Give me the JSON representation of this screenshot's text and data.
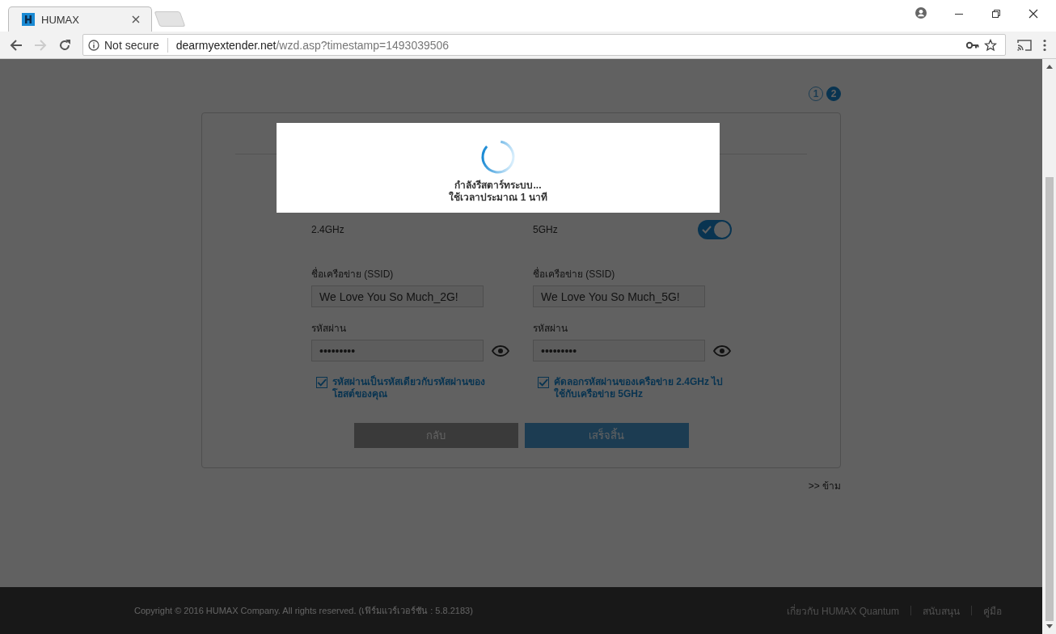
{
  "browser": {
    "tab_title": "HUMAX",
    "security": "Not secure",
    "url_host": "dearmyextender.net",
    "url_path": "/wzd.asp?timestamp=1493039506"
  },
  "steps": [
    {
      "label": "1",
      "selected": false
    },
    {
      "label": "2",
      "selected": true
    }
  ],
  "bands": [
    {
      "label": "2.4GHz",
      "ssid_label": "ชื่อเครือข่าย (SSID)",
      "ssid": "We Love You So Much_2G!",
      "password_label": "รหัสผ่าน",
      "password": "•••••••••",
      "option": {
        "label": "รหัสผ่านเป็นรหัสเดียวกับรหัสผ่านของโฮสต์ของคุณ",
        "checked": true
      }
    },
    {
      "label": "5GHz",
      "toggle": {
        "on": true
      },
      "ssid_label": "ชื่อเครือข่าย (SSID)",
      "ssid": "We Love You So Much_5G!",
      "password_label": "รหัสผ่าน",
      "password": "•••••••••",
      "option": {
        "label": "คัดลอกรหัสผ่านของเครือข่าย 2.4GHz ไปใช้กับเครือข่าย 5GHz",
        "checked": true
      }
    }
  ],
  "buttons": {
    "back": "กลับ",
    "finish": "เสร็จสิ้น"
  },
  "skip_link": ">> ข้าม",
  "footer": {
    "copyright": "Copyright © 2016 HUMAX Company. All rights reserved. (เฟิร์มแวร์เวอร์ชัน : 5.8.2183)",
    "links": [
      "เกี่ยวกับ HUMAX Quantum",
      "สนับสนุน",
      "คู่มือ"
    ]
  },
  "modal": {
    "lines": [
      "กำลังรีสตาร์ทระบบ...",
      "ใช้เวลาประมาณ 1 นาที"
    ]
  }
}
